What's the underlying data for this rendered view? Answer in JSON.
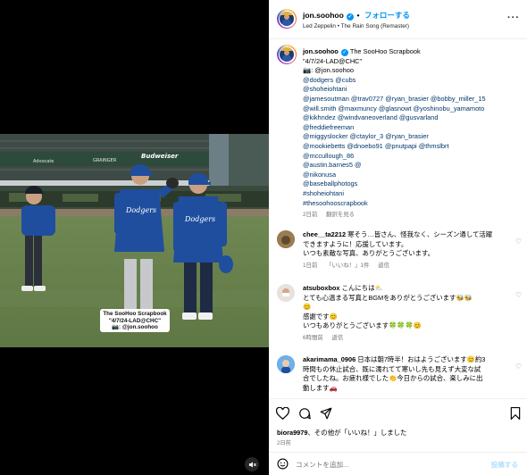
{
  "header": {
    "username": "jon.soohoo",
    "follow_label": "フォローする",
    "separator": "•",
    "artist": "Led Zeppelin",
    "song": "The Rain Song (Remaster)"
  },
  "photo_overlay": {
    "lines": [
      "The SooHoo Scrapbook",
      "\"4/7/24-LAD@CHC\"",
      "📷: @jon.soohoo"
    ]
  },
  "caption": {
    "username": "jon.soohoo",
    "lines": [
      {
        "text": "The SooHoo Scrapbook",
        "style": "plain"
      },
      {
        "text": "\"4/7/24-LAD@CHC\"",
        "style": "plain"
      },
      {
        "text": "📷: @jon.soohoo",
        "style": "plain"
      },
      {
        "text": "@dodgers @cubs",
        "style": "link"
      },
      {
        "text": "@shoheiohtani",
        "style": "link"
      },
      {
        "text": "@jamesoutman @trav0727 @ryan_brasier @bobby_miller_15",
        "style": "link"
      },
      {
        "text": "@will.smith @maxmuncy @glasnowt @yoshinobu_yamamoto",
        "style": "link"
      },
      {
        "text": "@kikhndez @windvaneoverland @gusvarland",
        "style": "link"
      },
      {
        "text": "@freddiefreeman",
        "style": "link"
      },
      {
        "text": "@miggyslocker @ctaylor_3 @ryan_brasier",
        "style": "link"
      },
      {
        "text": "@mookiebetts @dnoebo91 @pnutpapi @thmslbrt",
        "style": "link"
      },
      {
        "text": "@mccullough_86",
        "style": "link"
      },
      {
        "text": "@austin.barnes5 @",
        "style": "link"
      },
      {
        "text": "@nikonusa",
        "style": "link"
      },
      {
        "text": "@baseballphotogs",
        "style": "link"
      },
      {
        "text": "#shoheiohtani",
        "style": "link"
      },
      {
        "text": "#thesoohooscrapbook",
        "style": "link"
      }
    ],
    "time": "2日前",
    "translate": "翻訳を見る"
  },
  "comments": [
    {
      "username": "chee__ta2212",
      "lines": [
        "寒そう…皆さん、怪我なく、シーズン通して活躍",
        "できますように！応援しています。",
        "いつも素敵な写真、ありがとうございます。"
      ],
      "time": "1日前",
      "likes": "「いいね！」1件",
      "reply": "返信"
    },
    {
      "username": "atsuboxbox",
      "lines": [
        "こんにちは⛅",
        "とても心温まる写真とBGMをありがとうございます🐝🐝",
        "😊",
        "感謝です😊",
        "いつもありがとうございます🍀🍀🍀😊"
      ],
      "time": "6時間前",
      "reply": "返信"
    },
    {
      "username": "akarimama_0906",
      "lines": [
        "日本は朝7時半！おはようございます😊約3",
        "時間もの休止試合、既に濡れてて寒いし先も見えず大変な試",
        "合でしたね。お疲れ様でした👏今日からの試合、楽しみに出",
        "動します🚗"
      ]
    }
  ],
  "likes_text": {
    "user": "biora9979",
    "mid": "、その他",
    "rest": "が「いいね！」しました"
  },
  "post_date": "2日前",
  "composer": {
    "placeholder": "コメントを追加...",
    "post_label": "投稿する"
  },
  "colors": {
    "accent": "#0095f6",
    "link": "#00376b",
    "muted": "#737373",
    "dodger_blue": "#1f4e9e"
  },
  "icons": [
    "more-icon",
    "heart-icon",
    "comment-icon",
    "share-icon",
    "bookmark-icon",
    "emoji-icon",
    "mute-icon",
    "verified-icon",
    "camera-icon"
  ]
}
